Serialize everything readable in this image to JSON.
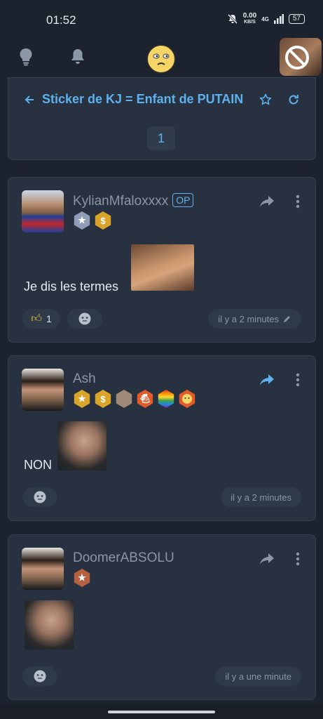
{
  "status": {
    "time": "01:52",
    "netspeed": "0.00",
    "netunit": "KB/S",
    "network": "4G",
    "battery": "57"
  },
  "topic": {
    "title": "Sticker de KJ = Enfant de PUTAIN",
    "page": "1"
  },
  "posts": [
    {
      "username": "KylianMfaloxxxx",
      "op_label": "OP",
      "text": "Je dis les termes",
      "likes": "1",
      "time": "il y a 2 minutes"
    },
    {
      "username": "Ash",
      "text": "NON",
      "time": "il y a 2 minutes"
    },
    {
      "username": "DoomerABSOLU",
      "text": "",
      "time": "il y a une minute"
    }
  ],
  "colors": {
    "accent": "#5fb1ee",
    "background": "#1c232e",
    "card": "#273140"
  }
}
